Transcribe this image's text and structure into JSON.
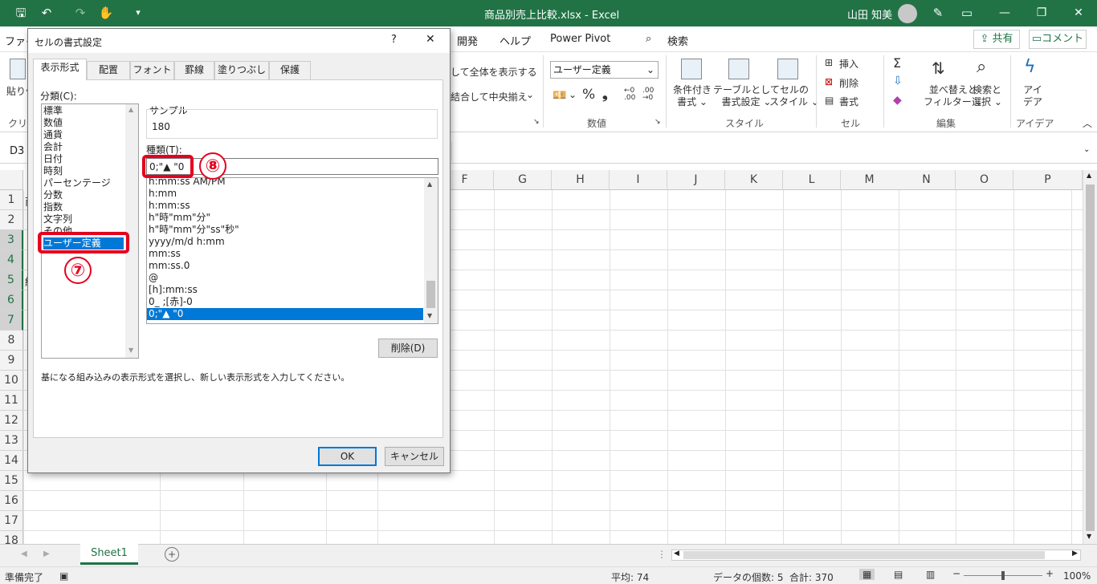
{
  "app": {
    "file_title": "商品別売上比較.xlsx - Excel",
    "user_name": "山田 知美"
  },
  "menu": {
    "items": [
      "ファイ",
      "開発",
      "ヘルプ",
      "Power Pivot"
    ],
    "search": "検索",
    "share": "共有",
    "comment": "コメント"
  },
  "ribbon": {
    "paste_partial": "貼り付",
    "clip_partial": "クリッ",
    "wrap_text": "して全体を表示する",
    "merge_center": "結合して中央揃え",
    "number_format": "ユーザー定義",
    "group_number": "数値",
    "cond_format": [
      "条件付き",
      "書式"
    ],
    "table_format": [
      "テーブルとして",
      "書式設定"
    ],
    "cell_style": [
      "セルの",
      "スタイル"
    ],
    "group_style": "スタイル",
    "insert": "挿入",
    "delete": "削除",
    "format": "書式",
    "group_cells": "セル",
    "sort_filter": [
      "並べ替えと",
      "フィルター"
    ],
    "find_select": [
      "検索と",
      "選択"
    ],
    "group_edit": "編集",
    "ideas": [
      "アイ",
      "デア"
    ],
    "group_ideas": "アイデア"
  },
  "formula_bar": {
    "name_box": "D3"
  },
  "grid": {
    "columns": [
      "F",
      "G",
      "H",
      "I",
      "J",
      "K",
      "L",
      "M",
      "N",
      "O",
      "P"
    ],
    "rows": [
      "1",
      "2",
      "3",
      "4",
      "5",
      "6",
      "7",
      "8",
      "9",
      "10",
      "11",
      "12",
      "13",
      "14",
      "15",
      "16",
      "17",
      "18"
    ],
    "row_partial_text": [
      "商",
      "",
      "",
      "",
      "純",
      "",
      ""
    ]
  },
  "sheet": {
    "tab_name": "Sheet1"
  },
  "status": {
    "ready": "準備完了",
    "average": "平均: 74",
    "count": "データの個数: 5",
    "sum": "合計: 370",
    "zoom": "100%"
  },
  "dialog": {
    "title": "セルの書式設定",
    "help": "?",
    "close": "✕",
    "tabs": [
      "表示形式",
      "配置",
      "フォント",
      "罫線",
      "塗りつぶし",
      "保護"
    ],
    "category_label": "分類(C):",
    "categories": [
      "標準",
      "数値",
      "通貨",
      "会計",
      "日付",
      "時刻",
      "パーセンテージ",
      "分数",
      "指数",
      "文字列",
      "その他",
      "ユーザー定義"
    ],
    "selected_category": "ユーザー定義",
    "sample_label": "サンプル",
    "sample_value": "180",
    "type_label": "種類(T):",
    "type_value": "0;\"▲ \"0",
    "type_list": [
      "h:mm:ss AM/PM",
      "h:mm",
      "h:mm:ss",
      "h\"時\"mm\"分\"",
      "h\"時\"mm\"分\"ss\"秒\"",
      "yyyy/m/d h:mm",
      "mm:ss",
      "mm:ss.0",
      "@",
      "[h]:mm:ss",
      "0_ ;[赤]-0",
      "0;\"▲ \"0"
    ],
    "delete_button": "削除(D)",
    "description": "基になる組み込みの表示形式を選択し、新しい表示形式を入力してください。",
    "ok": "OK",
    "cancel": "キャンセル"
  },
  "annotations": {
    "step7": "⑦",
    "step8": "⑧"
  },
  "colors": {
    "excel_green": "#217346",
    "select_blue": "#0078d7",
    "annotation_red": "#e6001e"
  }
}
